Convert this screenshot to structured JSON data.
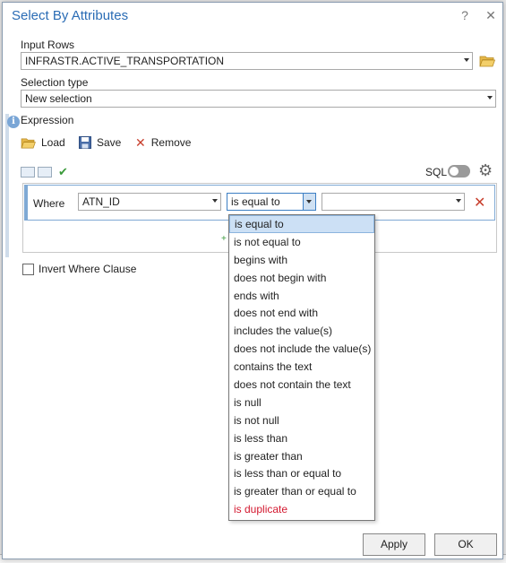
{
  "title": "Select By Attributes",
  "title_buttons": {
    "help": "?",
    "close": "✕"
  },
  "input_rows": {
    "label": "Input Rows",
    "value": "INFRASTR.ACTIVE_TRANSPORTATION"
  },
  "selection_type": {
    "label": "Selection type",
    "value": "New selection"
  },
  "expression": {
    "label": "Expression",
    "info_icon": "i",
    "toolbar": {
      "load": "Load",
      "save": "Save",
      "remove": "Remove"
    },
    "sql_label": "SQL",
    "sql_toggle_on": false,
    "clause": {
      "where_label": "Where",
      "field": "ATN_ID",
      "operator": "is equal to",
      "value": ""
    }
  },
  "invert": {
    "label": "Invert Where Clause",
    "checked": false
  },
  "operator_options": [
    {
      "label": "is equal to",
      "selected": true
    },
    {
      "label": "is not equal to"
    },
    {
      "label": "begins with"
    },
    {
      "label": "does not begin with"
    },
    {
      "label": "ends with"
    },
    {
      "label": "does not end with"
    },
    {
      "label": "includes the value(s)"
    },
    {
      "label": "does not include the value(s)"
    },
    {
      "label": "contains the text"
    },
    {
      "label": "does not contain the text"
    },
    {
      "label": "is null"
    },
    {
      "label": "is not null"
    },
    {
      "label": "is less than"
    },
    {
      "label": "is greater than"
    },
    {
      "label": "is less than or equal to"
    },
    {
      "label": "is greater than or equal to"
    },
    {
      "label": "is duplicate",
      "color": "#d3182f"
    }
  ],
  "buttons": {
    "apply": "Apply",
    "ok": "OK"
  },
  "colors": {
    "title": "#2a6cb5",
    "accent": "#3c7fc4",
    "remove_x": "#c8402e",
    "check": "#3a9a3a"
  },
  "icons": [
    "folder-open-icon",
    "save-disk-icon",
    "remove-x-icon",
    "info-icon",
    "gear-icon",
    "check-icon",
    "chevron-down-icon"
  ]
}
